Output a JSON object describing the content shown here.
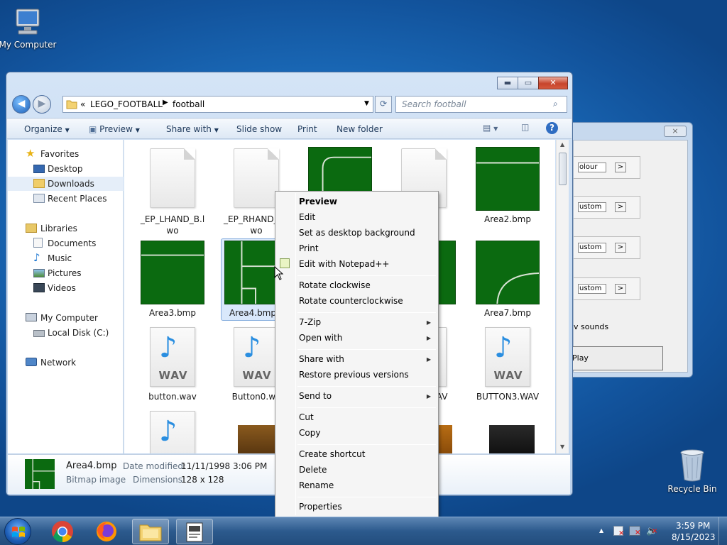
{
  "desktop": {
    "icons": [
      {
        "label": "My Computer"
      },
      {
        "label": "Recycle Bin"
      }
    ]
  },
  "bg_window": {
    "close": "⨯",
    "rows": [
      {
        "value": "olour",
        "arrow": ">"
      },
      {
        "value": "ustom",
        "arrow": ">"
      },
      {
        "value": "ustom",
        "arrow": ">"
      },
      {
        "value": "ustom",
        "arrow": ">"
      }
    ],
    "sounds_label": "v sounds",
    "play_label": "Play"
  },
  "window": {
    "controls": {
      "minimize": "▬",
      "maximize": "▭",
      "close": "✕"
    },
    "address": {
      "prefix": "«",
      "crumbs": [
        "LEGO_FOOTBALL",
        "football"
      ]
    },
    "search_placeholder": "Search football",
    "toolbar": [
      "Organize",
      "Preview",
      "Share with",
      "Slide show",
      "Print",
      "New folder"
    ],
    "nav": [
      {
        "label": "Favorites",
        "icon": "star-icon"
      },
      {
        "label": "Desktop",
        "icon": "desktop-icon"
      },
      {
        "label": "Downloads",
        "icon": "downloads-icon"
      },
      {
        "label": "Recent Places",
        "icon": "recent-places-icon"
      },
      {
        "label": "Libraries",
        "icon": "libraries-icon"
      },
      {
        "label": "Documents",
        "icon": "documents-icon"
      },
      {
        "label": "Music",
        "icon": "music-icon"
      },
      {
        "label": "Pictures",
        "icon": "pictures-icon"
      },
      {
        "label": "Videos",
        "icon": "videos-icon"
      },
      {
        "label": "My Computer",
        "icon": "computer-icon"
      },
      {
        "label": "Local Disk (C:)",
        "icon": "disk-icon"
      },
      {
        "label": "Network",
        "icon": "network-icon"
      }
    ],
    "files": [
      {
        "name": "_EP_LHAND_B.lwo",
        "kind": "doc"
      },
      {
        "name": "_EP_RHAND_B.lwo",
        "kind": "doc"
      },
      {
        "name": "",
        "kind": "field-corner"
      },
      {
        "name": "a",
        "kind": "doc"
      },
      {
        "name": "Area2.bmp",
        "kind": "field"
      },
      {
        "name": "Area3.bmp",
        "kind": "field"
      },
      {
        "name": "Area4.bmp",
        "kind": "field-box"
      },
      {
        "name": "mp",
        "kind": "field"
      },
      {
        "name": "Area7.bmp",
        "kind": "field-arc"
      },
      {
        "name": "button.wav",
        "kind": "wav"
      },
      {
        "name": "Button0.wa",
        "kind": "wav"
      },
      {
        "name": "WAV",
        "kind": "wav"
      },
      {
        "name": "BUTTON3.WAV",
        "kind": "wav"
      }
    ],
    "wav_text": "WAV",
    "status": {
      "name": "Area4.bmp",
      "type": "Bitmap image",
      "modified_label": "Date modified:",
      "modified": "11/11/1998 3:06 PM",
      "dims_label": "Dimensions:",
      "dims": "128 x 128"
    }
  },
  "context_menu": {
    "items": [
      {
        "label": "Preview",
        "bold": true
      },
      {
        "label": "Edit"
      },
      {
        "label": "Set as desktop background"
      },
      {
        "label": "Print"
      },
      {
        "label": "Edit with Notepad++"
      },
      {
        "label": "Rotate clockwise"
      },
      {
        "label": "Rotate counterclockwise"
      },
      {
        "label": "7-Zip",
        "submenu": true
      },
      {
        "label": "Open with",
        "submenu": true
      },
      {
        "label": "Share with",
        "submenu": true
      },
      {
        "label": "Restore previous versions"
      },
      {
        "label": "Send to",
        "submenu": true
      },
      {
        "label": "Cut"
      },
      {
        "label": "Copy"
      },
      {
        "label": "Create shortcut"
      },
      {
        "label": "Delete"
      },
      {
        "label": "Rename"
      },
      {
        "label": "Properties"
      }
    ]
  },
  "taskbar": {
    "time": "3:59 PM",
    "date": "8/15/2023",
    "tray_up": "▲"
  }
}
